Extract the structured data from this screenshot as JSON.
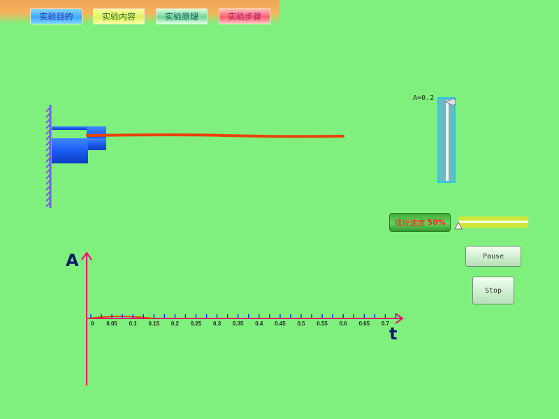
{
  "tabs": [
    {
      "label": "实验目的"
    },
    {
      "label": "实验内容"
    },
    {
      "label": "实验原理"
    },
    {
      "label": "实验步骤"
    }
  ],
  "amplitude": {
    "label": "A=0.2",
    "value": 0.2
  },
  "speed": {
    "label": "播放速度",
    "value": "50%"
  },
  "buttons": {
    "pause": "Pause",
    "stop": "Stop"
  },
  "graph": {
    "y_label": "A",
    "x_label": "t",
    "ticks": [
      "0",
      "0.05",
      "0.1",
      "0.15",
      "0.2",
      "0.25",
      "0.3",
      "0.35",
      "0.4",
      "0.45",
      "0.5",
      "0.55",
      "0.6",
      "0.65",
      "0.7"
    ]
  },
  "colors": {
    "background": "#7ff07d",
    "axis": "#e8106e",
    "wave": "#e8420a",
    "block": "#1a5cf0",
    "wall": "#7a5ce6"
  }
}
